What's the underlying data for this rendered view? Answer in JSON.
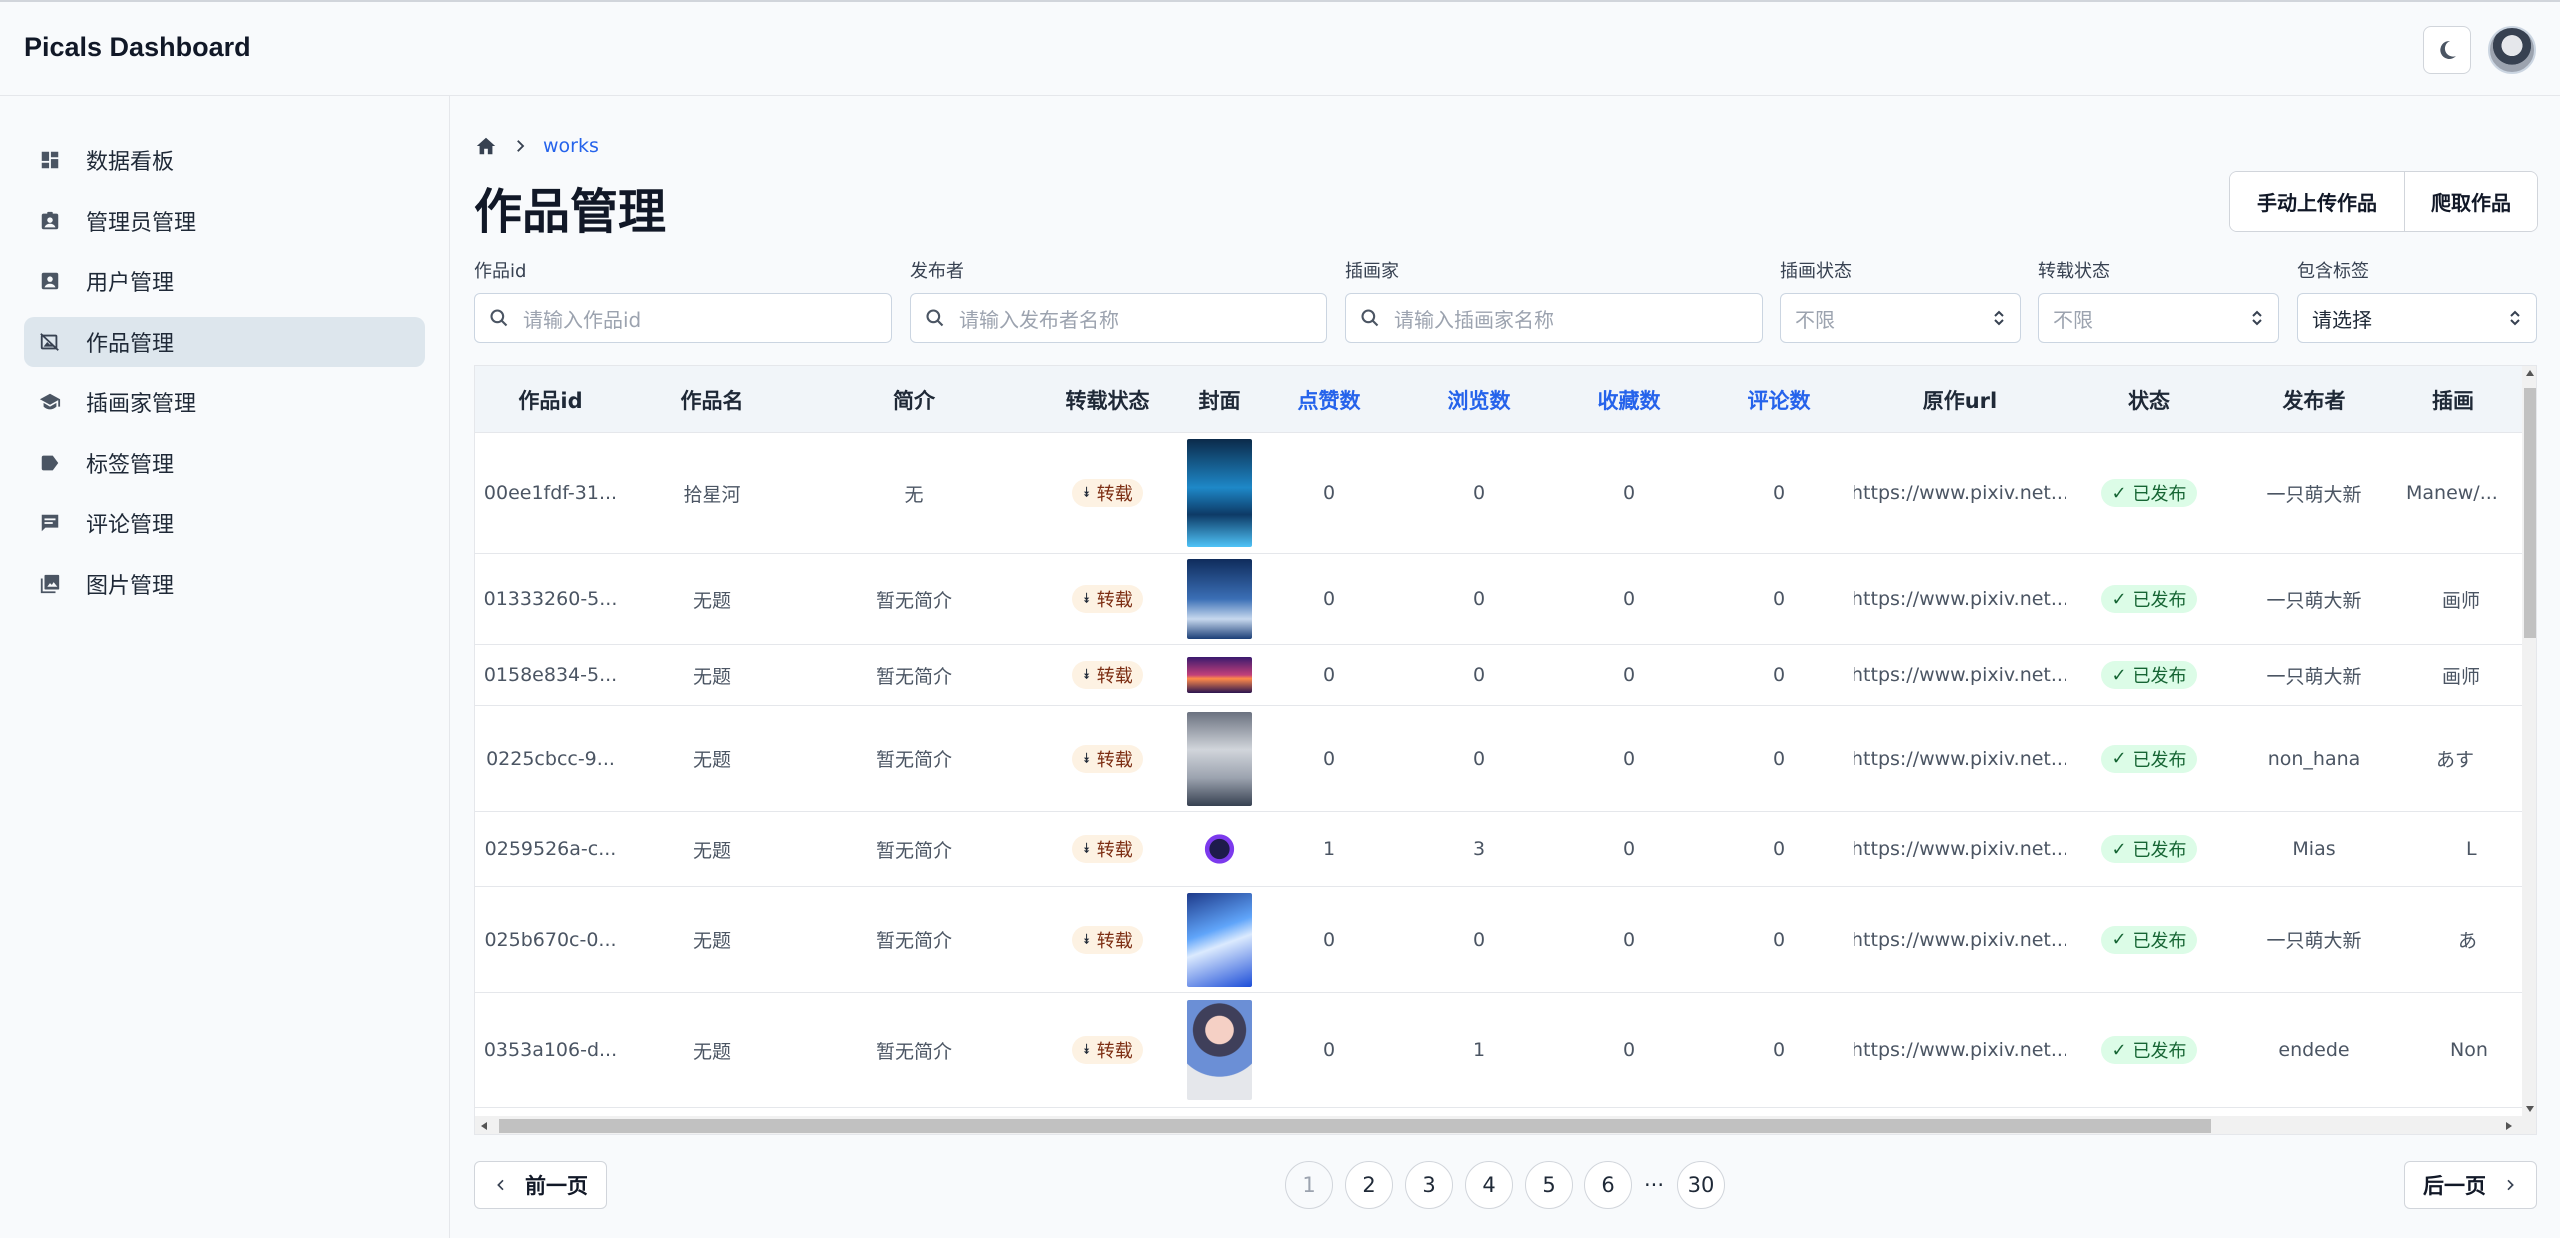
{
  "app": {
    "title": "Picals Dashboard"
  },
  "sidebar": {
    "items": [
      {
        "label": "数据看板",
        "icon": "dashboard-icon"
      },
      {
        "label": "管理员管理",
        "icon": "admin-badge-icon"
      },
      {
        "label": "用户管理",
        "icon": "user-card-icon"
      },
      {
        "label": "作品管理",
        "icon": "image-off-icon",
        "active": true
      },
      {
        "label": "插画家管理",
        "icon": "graduation-cap-icon"
      },
      {
        "label": "标签管理",
        "icon": "tag-icon"
      },
      {
        "label": "评论管理",
        "icon": "comment-icon"
      },
      {
        "label": "图片管理",
        "icon": "image-stack-icon"
      }
    ]
  },
  "breadcrumb": {
    "current": "works"
  },
  "page": {
    "title": "作品管理"
  },
  "actions": {
    "upload_label": "手动上传作品",
    "crawl_label": "爬取作品"
  },
  "filters": {
    "work_id": {
      "label": "作品id",
      "placeholder": "请输入作品id"
    },
    "publisher": {
      "label": "发布者",
      "placeholder": "请输入发布者名称"
    },
    "illustrator": {
      "label": "插画家",
      "placeholder": "请输入插画家名称"
    },
    "illus_status": {
      "label": "插画状态",
      "value": "不限"
    },
    "repost_status": {
      "label": "转载状态",
      "value": "不限"
    },
    "tags": {
      "label": "包含标签",
      "value": "请选择"
    }
  },
  "table": {
    "columns": [
      "作品id",
      "作品名",
      "简介",
      "转载状态",
      "封面",
      "点赞数",
      "浏览数",
      "收藏数",
      "评论数",
      "原作url",
      "状态",
      "发布者",
      "插画"
    ],
    "rows": [
      {
        "id": "00ee1fdf-31...",
        "name": "拾星河",
        "intro": "无",
        "repost": "转载",
        "likes": "0",
        "views": "0",
        "favs": "0",
        "comments": "0",
        "url": "https://www.pixiv.net...",
        "status": "已发布",
        "publisher": "一只萌大新",
        "illustrator": "Manew/..."
      },
      {
        "id": "01333260-5...",
        "name": "无题",
        "intro": "暂无简介",
        "repost": "转载",
        "likes": "0",
        "views": "0",
        "favs": "0",
        "comments": "0",
        "url": "https://www.pixiv.net...",
        "status": "已发布",
        "publisher": "一只萌大新",
        "illustrator": "画师"
      },
      {
        "id": "0158e834-5...",
        "name": "无题",
        "intro": "暂无简介",
        "repost": "转载",
        "likes": "0",
        "views": "0",
        "favs": "0",
        "comments": "0",
        "url": "https://www.pixiv.net...",
        "status": "已发布",
        "publisher": "一只萌大新",
        "illustrator": "画师"
      },
      {
        "id": "0225cbcc-9...",
        "name": "无题",
        "intro": "暂无简介",
        "repost": "转载",
        "likes": "0",
        "views": "0",
        "favs": "0",
        "comments": "0",
        "url": "https://www.pixiv.net...",
        "status": "已发布",
        "publisher": "non_hana",
        "illustrator": "あす"
      },
      {
        "id": "0259526a-c...",
        "name": "无题",
        "intro": "暂无简介",
        "repost": "转载",
        "likes": "1",
        "views": "3",
        "favs": "0",
        "comments": "0",
        "url": "https://www.pixiv.net...",
        "status": "已发布",
        "publisher": "Mias",
        "illustrator": "L"
      },
      {
        "id": "025b670c-0...",
        "name": "无题",
        "intro": "暂无简介",
        "repost": "转载",
        "likes": "0",
        "views": "0",
        "favs": "0",
        "comments": "0",
        "url": "https://www.pixiv.net...",
        "status": "已发布",
        "publisher": "一只萌大新",
        "illustrator": "あ"
      },
      {
        "id": "0353a106-d...",
        "name": "无题",
        "intro": "暂无简介",
        "repost": "转载",
        "likes": "0",
        "views": "1",
        "favs": "0",
        "comments": "0",
        "url": "https://www.pixiv.net...",
        "status": "已发布",
        "publisher": "endede",
        "illustrator": "Non"
      }
    ]
  },
  "pagination": {
    "prev_label": "前一页",
    "next_label": "后一页",
    "pages": [
      "1",
      "2",
      "3",
      "4",
      "5",
      "6"
    ],
    "ellipsis": "···",
    "last": "30",
    "current": "1"
  },
  "colors": {
    "accent": "#2563eb",
    "active_nav": "#dde6ed",
    "published_bg": "#dcfce7",
    "repost_bg": "#fdf2e3"
  }
}
